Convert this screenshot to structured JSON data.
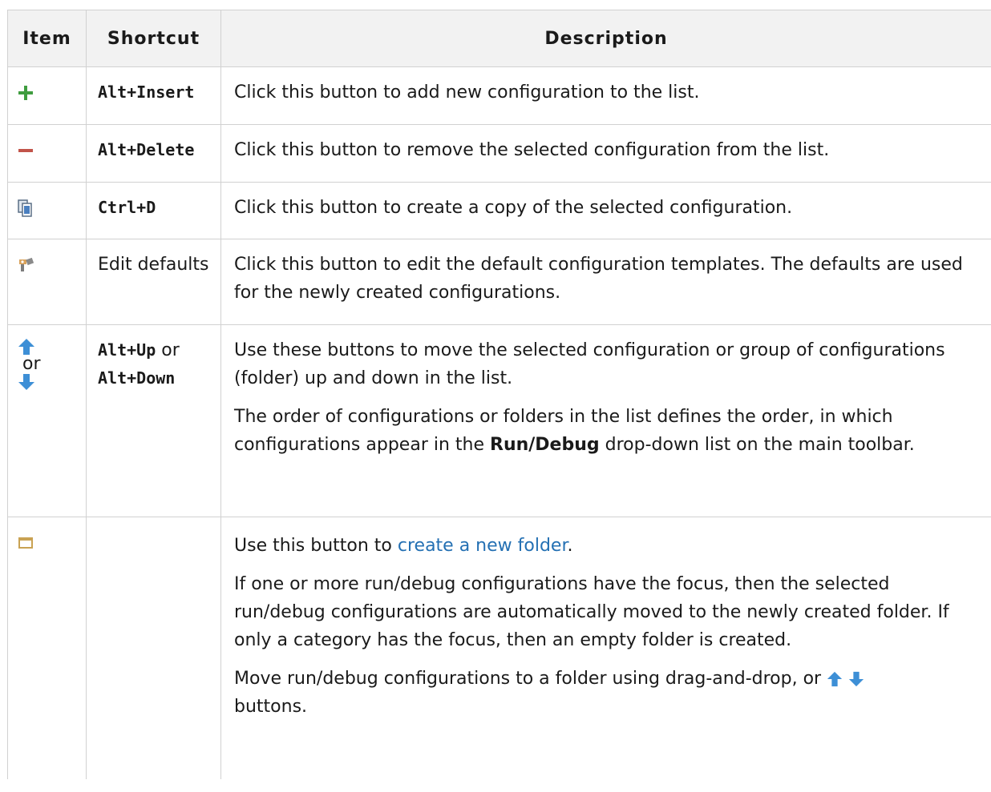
{
  "headers": {
    "item": "Item",
    "shortcut": "Shortcut",
    "description": "Description"
  },
  "rows": [
    {
      "icon": "plus-icon",
      "shortcut": "Alt+Insert",
      "desc": "Click this button to add new configuration to the list."
    },
    {
      "icon": "minus-icon",
      "shortcut": "Alt+Delete",
      "desc": "Click this button to remove the selected configuration from the list."
    },
    {
      "icon": "copy-icon",
      "shortcut": "Ctrl+D",
      "desc": "Click this button to create a copy of the selected configuration."
    },
    {
      "icon": "wrench-icon",
      "shortcut_text": "Edit defaults",
      "desc": "Click this button to edit the default configuration templates. The defaults are used for the newly created configurations."
    },
    {
      "icon": "arrow-up-icon",
      "icon_or": "or",
      "icon2": "arrow-down-icon",
      "shortcut1": "Alt+Up",
      "shortcut_or": "or",
      "shortcut2": "Alt+Down",
      "desc": "Use these buttons to move the selected configuration or group of configurations (folder) up and down in the list.",
      "desc2_pre": "The order of configurations or folders in the list defines the order, in which configurations appear in the ",
      "desc2_bold": "Run/Debug",
      "desc2_post": " drop-down list on the main toolbar."
    },
    {
      "icon": "folder-icon",
      "desc_pre": "Use this button to ",
      "desc_link": "create a new folder",
      "desc_post": ".",
      "desc2": "If one or more run/debug configurations have the focus, then the selected run/debug configurations are automatically moved to the newly created folder. If only a category has the focus, then an empty folder is created.",
      "desc3_pre": "Move run/debug configurations to a folder using drag-and-drop, or ",
      "desc3_post": "buttons."
    }
  ],
  "colors": {
    "plus": "#3f9d3f",
    "minus": "#c2544a",
    "arrow": "#3d8fd6",
    "folder": "#c9a253",
    "link": "#2470b3"
  }
}
